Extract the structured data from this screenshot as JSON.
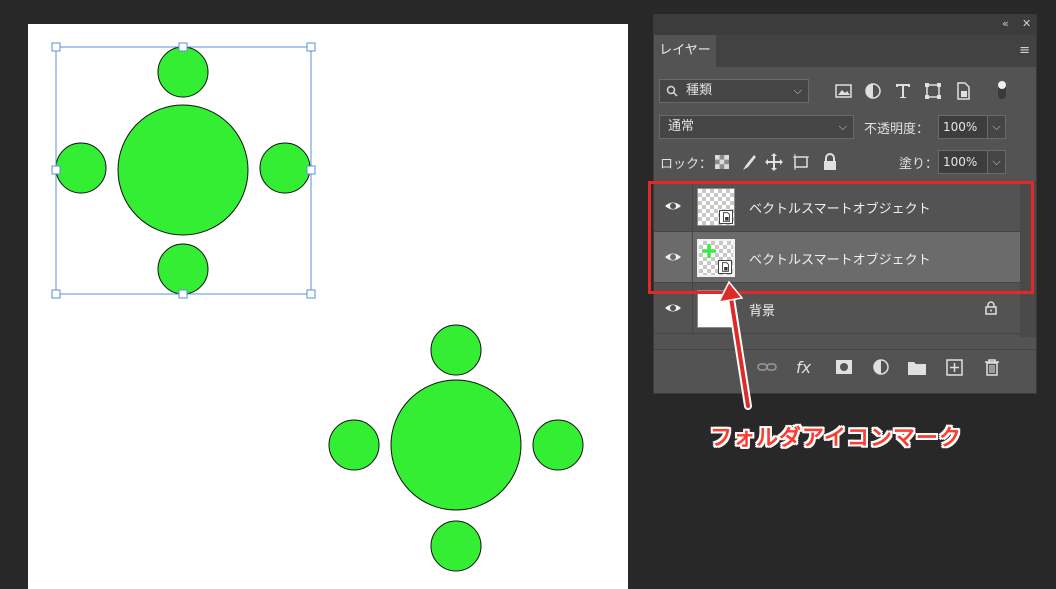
{
  "panel": {
    "tab_label": "レイヤー",
    "collapse_icon": "double-chevron-left-icon",
    "close_icon": "close-icon",
    "menu_icon": "panel-menu-icon",
    "filter": {
      "label": "種類",
      "icon": "search-icon"
    },
    "filter_icons": [
      "image-filter-icon",
      "adjustment-filter-icon",
      "type-filter-icon",
      "shape-filter-icon",
      "smart-object-filter-icon",
      "filter-toggle-icon"
    ],
    "blend_mode": "通常",
    "opacity_label": "不透明度：",
    "opacity_value": "100%",
    "lock_label": "ロック：",
    "lock_icons": [
      "lock-transparent-pixels-icon",
      "lock-image-pixels-icon",
      "lock-position-icon",
      "lock-artboard-icon",
      "lock-all-icon"
    ],
    "fill_label": "塗り：",
    "fill_value": "100%",
    "layers": [
      {
        "name": "ベクトルスマートオブジェクト",
        "visible": true,
        "selected": false,
        "type": "smart-object"
      },
      {
        "name": "ベクトルスマートオブジェクト",
        "visible": true,
        "selected": true,
        "type": "smart-object-linked"
      },
      {
        "name": "背景",
        "visible": true,
        "selected": false,
        "type": "background",
        "locked": true
      }
    ],
    "bottom_icons": [
      "link-layers-icon",
      "fx-icon",
      "add-mask-icon",
      "adjustment-layer-icon",
      "new-group-folder-icon",
      "new-layer-icon",
      "delete-icon"
    ],
    "fx_label": "fx"
  },
  "annotation": {
    "text": "フォルダアイコンマーク",
    "color": "#ff3b2f",
    "highlight_color": "#e02a2a"
  },
  "colors": {
    "shape_fill": "#33ee33",
    "selection": "#5b8fd8",
    "panel_bg": "#535353",
    "workspace_bg": "#282828"
  }
}
